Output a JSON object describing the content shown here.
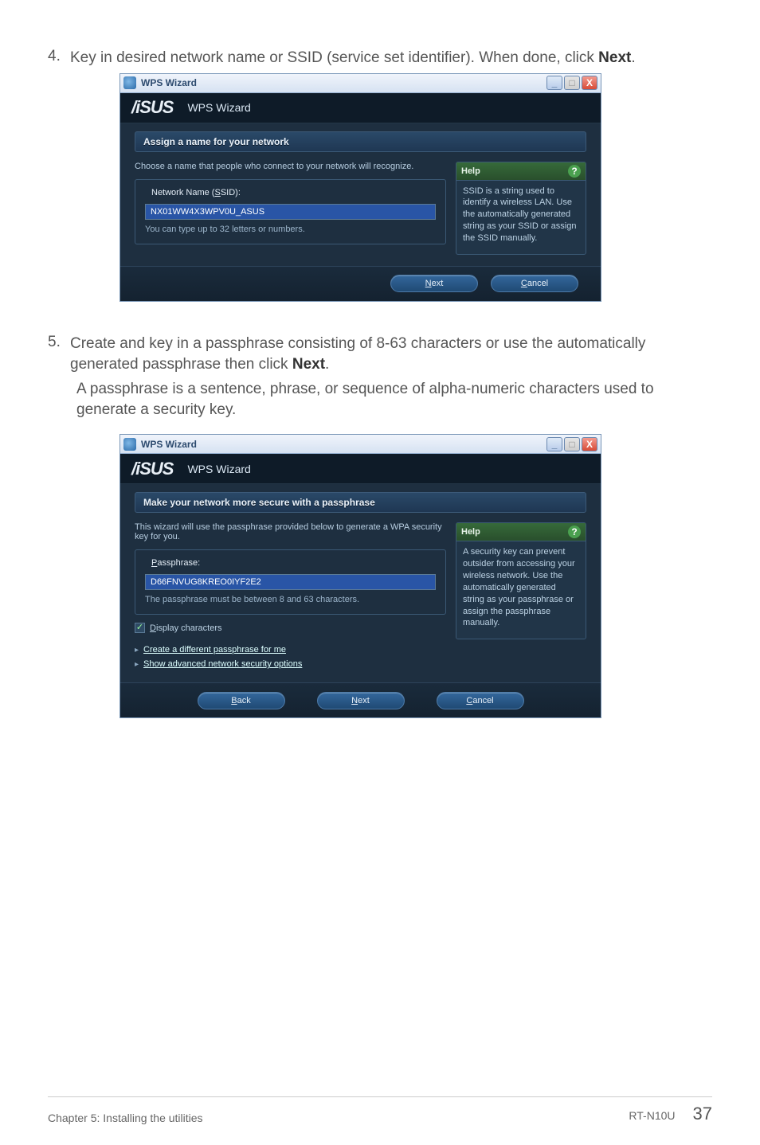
{
  "steps": {
    "s4": {
      "num": "4.",
      "text_a": "Key in desired network name or SSID (service set identifier). When done, click ",
      "bold": "Next",
      "text_b": "."
    },
    "s5": {
      "num": "5.",
      "text_a": "Create and key in a passphrase consisting of 8-63 characters or use the automatically generated passphrase then click ",
      "bold": "Next",
      "text_b": "."
    },
    "s5_para": "A passphrase is a sentence, phrase, or sequence of alpha-numeric characters used to generate a security key."
  },
  "wiz_common": {
    "title": "WPS Wizard",
    "brand": "/iSUS",
    "brand_sub": "WPS Wizard",
    "min": "_",
    "max": "□",
    "close": "X",
    "help_label": "Help",
    "help_q": "?",
    "next": "Next",
    "next_u": "N",
    "back": "Back",
    "back_u": "B",
    "cancel": "Cancel",
    "cancel_u": "C"
  },
  "wiz1": {
    "section_head": "Assign a name for your network",
    "lead": "Choose a name that people who connect to your network will recognize.",
    "field_legend_pre": "Network Name (",
    "field_legend_u": "S",
    "field_legend_post": "SID):",
    "value": "NX01WW4X3WPV0U_ASUS",
    "hint": "You can type up to 32 letters or numbers.",
    "help_body": "SSID is a string used to identify a wireless LAN. Use the automatically generated string as your SSID or assign the SSID manually."
  },
  "wiz2": {
    "section_head": "Make your network more secure with a passphrase",
    "lead": "This wizard will use the passphrase provided below to generate a WPA security key for you.",
    "field_legend_u": "P",
    "field_legend_post": "assphrase:",
    "value": "D66FNVUG8KREO0IYF2E2",
    "hint": "The passphrase must be between 8 and 63 characters.",
    "cb_label_u": "D",
    "cb_label": "isplay characters",
    "link1": "Create a different passphrase for me",
    "link2": "Show advanced network security options",
    "help_body": "A security key can prevent outsider from accessing your wireless network. Use the automatically generated string as your passphrase or assign the passphrase manually."
  },
  "footer": {
    "left": "Chapter 5: Installing the utilities",
    "model": "RT-N10U",
    "page": "37"
  }
}
